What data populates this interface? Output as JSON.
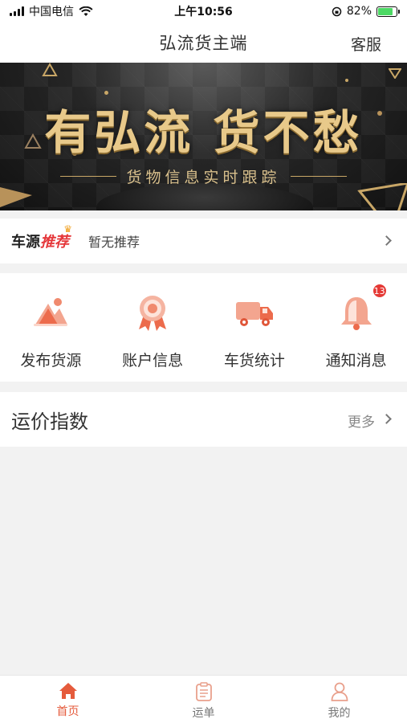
{
  "status_bar": {
    "carrier": "中国电信",
    "time": "上午10:56",
    "battery_percent": "82%",
    "battery_level": 0.82
  },
  "nav": {
    "title": "弘流货主端",
    "service": "客服"
  },
  "banner": {
    "headline": "有弘流 货不愁",
    "subheadline": "货物信息实时跟踪"
  },
  "vehicle_source": {
    "label_prefix": "车源",
    "label_highlight": "推荐",
    "text": "暂无推荐"
  },
  "quick_menu": [
    {
      "label": "发布货源",
      "icon": "publish-icon"
    },
    {
      "label": "账户信息",
      "icon": "account-badge-icon"
    },
    {
      "label": "车货统计",
      "icon": "truck-icon"
    },
    {
      "label": "通知消息",
      "icon": "bell-icon",
      "badge": "13"
    }
  ],
  "freight_index": {
    "title": "运价指数",
    "more": "更多"
  },
  "tabs": [
    {
      "label": "首页",
      "icon": "home-icon",
      "active": true
    },
    {
      "label": "运单",
      "icon": "waybill-icon",
      "active": false
    },
    {
      "label": "我的",
      "icon": "user-icon",
      "active": false
    }
  ],
  "colors": {
    "accent": "#e55b3c",
    "badge": "#e53935",
    "gold": "#e8c98a"
  }
}
